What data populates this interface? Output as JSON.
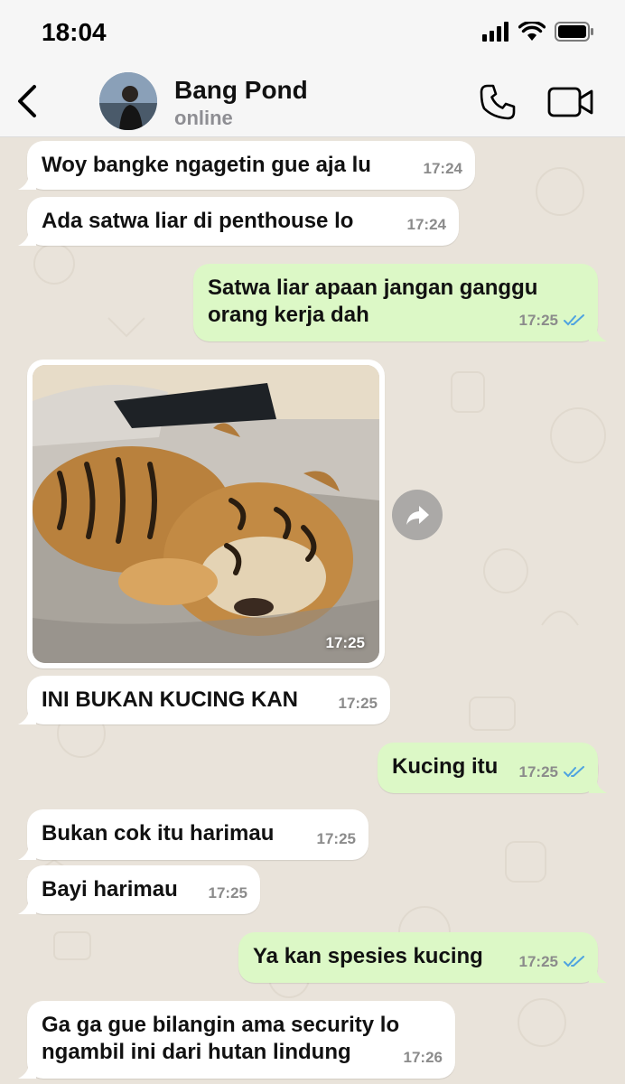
{
  "status_bar": {
    "time": "18:04"
  },
  "header": {
    "contact_name": "Bang Pond",
    "contact_status": "online"
  },
  "colors": {
    "incoming_bubble": "#ffffff",
    "outgoing_bubble": "#dcf8c6",
    "chat_background": "#e9e3da",
    "read_receipt": "#4fa3e0"
  },
  "messages": [
    {
      "direction": "in",
      "text": "Woy bangke ngagetin gue aja lu",
      "time": "17:24"
    },
    {
      "direction": "in",
      "text": "Ada satwa liar di penthouse lo",
      "time": "17:24"
    },
    {
      "direction": "out",
      "text": "Satwa liar apaan jangan ganggu\norang kerja dah",
      "time": "17:25",
      "read": true
    },
    {
      "direction": "in",
      "type": "image",
      "image": "sleeping-tiger-cub-photo",
      "time": "17:25"
    },
    {
      "direction": "in",
      "text": "INI BUKAN KUCING KAN",
      "time": "17:25"
    },
    {
      "direction": "out",
      "text": "Kucing itu",
      "time": "17:25",
      "read": true
    },
    {
      "direction": "in",
      "text": "Bukan cok itu harimau",
      "time": "17:25"
    },
    {
      "direction": "in",
      "text": "Bayi harimau",
      "time": "17:25"
    },
    {
      "direction": "out",
      "text": "Ya kan spesies kucing",
      "time": "17:25",
      "read": true
    },
    {
      "direction": "in",
      "text": "Ga ga gue bilangin ama security lo\nngambil ini dari hutan lindung",
      "time": "17:26"
    }
  ]
}
